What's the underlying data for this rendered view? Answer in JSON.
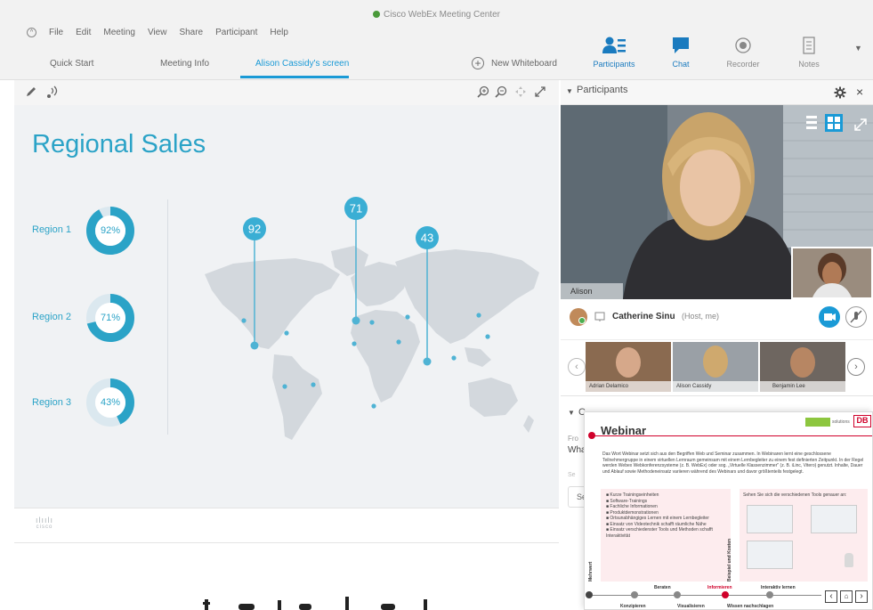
{
  "app": {
    "title": "Cisco WebEx Meeting Center"
  },
  "menu": {
    "items": [
      "File",
      "Edit",
      "Meeting",
      "View",
      "Share",
      "Participant",
      "Help"
    ]
  },
  "tabs": [
    {
      "label": "Quick Start"
    },
    {
      "label": "Meeting Info"
    },
    {
      "label": "Alison Cassidy's screen",
      "active": true
    }
  ],
  "toolbar": {
    "new_whiteboard": "New Whiteboard",
    "participants": "Participants",
    "chat": "Chat",
    "recorder": "Recorder",
    "notes": "Notes"
  },
  "slide": {
    "title": "Regional Sales",
    "regions": [
      {
        "label": "Region 1",
        "pct": 92,
        "text": "92%"
      },
      {
        "label": "Region 2",
        "pct": 71,
        "text": "71%"
      },
      {
        "label": "Region 3",
        "pct": 43,
        "text": "43%"
      }
    ],
    "pins": [
      {
        "value": "92"
      },
      {
        "value": "71"
      },
      {
        "value": "43"
      }
    ]
  },
  "footer": {
    "brand": "cisco"
  },
  "panel": {
    "title": "Participants",
    "video_name": "Alison Cassidy",
    "host_name": "Catherine Sinu",
    "host_role": "(Host, me)",
    "thumbnails": [
      {
        "name": "Adrian Delamico"
      },
      {
        "name": "Alison Cassidy"
      },
      {
        "name": "Benjamin Lee"
      }
    ]
  },
  "chat_fragments": {
    "from": "Fro",
    "what": "Wha",
    "send": "Se",
    "send2": "Se"
  },
  "doc": {
    "title": "Webinar",
    "logo_text": "solutions",
    "db": "DB",
    "intro": "Das Wort Webinar setzt sich aus den Begriffen Web und Seminar zusammen. In Webinaren lernt eine geschlossene Teilnehmergruppe in einem virtuellen Lernraum gemeinsam mit einem Lernbegleiter zu einem fest definierten Zeitpunkt. In der Regel werden Webex Webkonferenzsysteme (z. B. WebEx) oder sog. „Virtuelle Klassenzimmer\" (z. B. iLinc, Vitero) genutzt. Inhalte, Dauer und Ablauf sowie Methodeneinsatz variieren während des Webinars und davor größtenteils festgelegt.",
    "mehrwert_label": "Mehrwert",
    "bullets": [
      "Kurze Trainingseinheiten",
      "Software-Trainings",
      "Fachliche Informationen",
      "Produktdemonstrationen",
      "Ortsunabhängiges Lernen mit einem Lernbegleiter",
      "Einsatz von Videotechnik schafft räumliche Nähe",
      "Einsatz verschiedenster Tools und Methoden schafft Interaktivität"
    ],
    "beispiel_label": "Beispiel und Kosten",
    "tools_text": "Sehen Sie sich die verschiedenen Tools genauer an:",
    "timeline_top": [
      "Beraten",
      "Informieren",
      "Interaktiv lernen"
    ],
    "timeline_bottom": [
      "Konzipieren",
      "Visualisieren",
      "Wissen nachschlagen"
    ]
  },
  "colors": {
    "accent": "#1a9ad6",
    "slide_teal": "#2ba3c7",
    "doc_red": "#d0002a"
  }
}
